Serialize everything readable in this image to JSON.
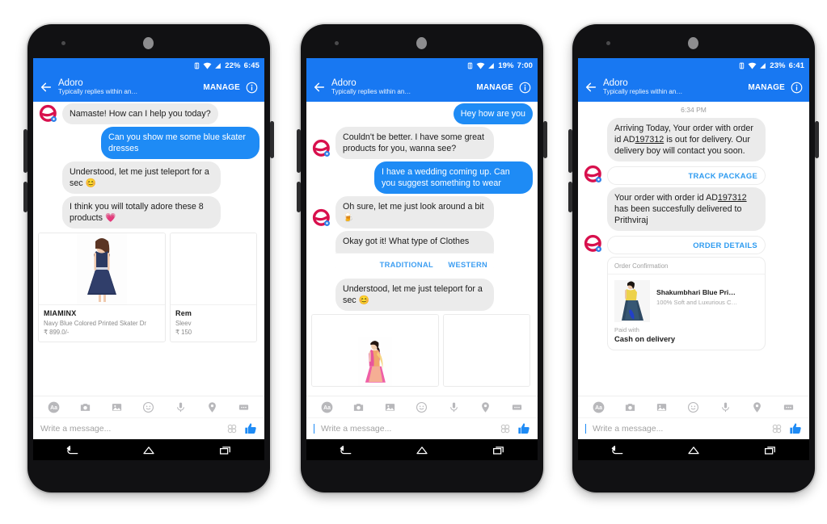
{
  "meta": {
    "app": "Messenger",
    "brand_color": "#1878f2",
    "outgoing_bubble_color": "#1e8bf5",
    "incoming_bubble_color": "#ebebeb",
    "link_color": "#2e9bf0",
    "avatar_color": "#d8104d"
  },
  "phones": [
    {
      "status": {
        "battery": "22%",
        "time": "6:45"
      },
      "appbar": {
        "title": "Adoro",
        "subtitle": "Typically replies within an…",
        "manage": "MANAGE"
      },
      "messages": [
        {
          "kind": "bubble",
          "dir": "in",
          "avatar": false,
          "text": "Namaste! How can I help you today?"
        },
        {
          "kind": "bubble",
          "dir": "out",
          "text": "Can you show me some blue skater dresses"
        },
        {
          "kind": "bubble",
          "dir": "in",
          "avatar": false,
          "text": "Understood, let me just teleport for a sec 😊"
        },
        {
          "kind": "bubble",
          "dir": "in",
          "avatar": false,
          "text": "I think you will totally adore these 8 products 💗"
        }
      ],
      "carousel": [
        {
          "title": "MIAMINX",
          "desc": "Navy Blue Colored Printed Skater Dr",
          "price": "₹ 899.0/-"
        },
        {
          "title": "Rem",
          "desc": "Sleev",
          "price": "₹ 150"
        }
      ],
      "composer": {
        "placeholder": "Write a message..."
      }
    },
    {
      "status": {
        "battery": "19%",
        "time": "7:00"
      },
      "appbar": {
        "title": "Adoro",
        "subtitle": "Typically replies within an…",
        "manage": "MANAGE"
      },
      "messages": [
        {
          "kind": "bubble",
          "dir": "out",
          "text": "Hey how are you"
        },
        {
          "kind": "bubble",
          "dir": "in",
          "avatar": true,
          "text": "Couldn't be better. I have some great products for you, wanna see?"
        },
        {
          "kind": "bubble",
          "dir": "out",
          "text": "I have a wedding coming up. Can you suggest something to wear"
        },
        {
          "kind": "bubble",
          "dir": "in",
          "avatar": true,
          "text": "Oh sure, let me just look around a bit 🍺"
        },
        {
          "kind": "quickreply",
          "dir": "in",
          "text": "Okay got it! What type of Clothes",
          "options": [
            "TRADITIONAL",
            "WESTERN"
          ]
        },
        {
          "kind": "bubble",
          "dir": "in",
          "avatar": false,
          "text": "Understood, let me just teleport for a sec 😊"
        }
      ],
      "carousel": [
        {
          "title": "",
          "desc": "",
          "price": ""
        }
      ],
      "composer": {
        "placeholder": "Write a message..."
      }
    },
    {
      "status": {
        "battery": "23%",
        "time": "6:41"
      },
      "appbar": {
        "title": "Adoro",
        "subtitle": "Typically replies within an…",
        "manage": "MANAGE"
      },
      "timestamp": "6:34 PM",
      "messages": [
        {
          "kind": "bubble",
          "dir": "in",
          "avatar": false,
          "text_pre": "Arriving Today, Your order with order id AD",
          "text_underline": "197312",
          "text_post": " is out for delivery. Our delivery boy will contact you soon."
        },
        {
          "kind": "link",
          "dir": "in",
          "avatar": true,
          "label": "TRACK PACKAGE"
        },
        {
          "kind": "bubble",
          "dir": "in",
          "avatar": false,
          "text_pre": "Your order with order id AD",
          "text_underline": "197312",
          "text_post": " has been succesfully delivered to Prithviraj"
        },
        {
          "kind": "link",
          "dir": "in",
          "avatar": true,
          "label": "ORDER DETAILS"
        }
      ],
      "order_card": {
        "header": "Order Confirmation",
        "product_name": "Shakumbhari Blue Pri…",
        "product_desc": "100% Soft and Luxurious C…",
        "paid_label": "Paid with",
        "paid_value": "Cash on delivery"
      },
      "composer": {
        "placeholder": "Write a message..."
      }
    }
  ],
  "toolbar_icons": [
    "text-format-icon",
    "camera-icon",
    "gallery-icon",
    "emoji-icon",
    "microphone-icon",
    "location-icon",
    "more-apps-icon"
  ],
  "nav_icons": [
    "back-nav-icon",
    "home-nav-icon",
    "recents-nav-icon"
  ]
}
